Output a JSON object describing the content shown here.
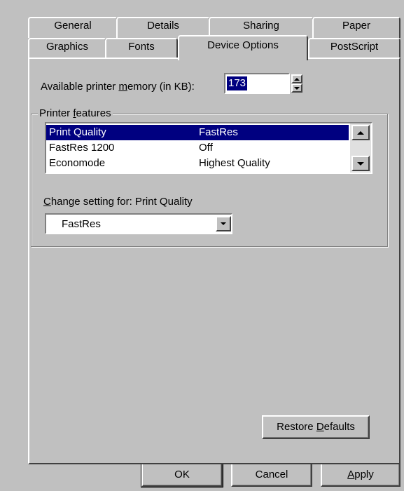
{
  "tabs_back": [
    {
      "label": "General"
    },
    {
      "label": "Details"
    },
    {
      "label": "Sharing"
    },
    {
      "label": "Paper"
    }
  ],
  "tabs_front": [
    {
      "label": "Graphics"
    },
    {
      "label": "Fonts"
    },
    {
      "label": "Device Options"
    },
    {
      "label": "PostScript"
    }
  ],
  "memory": {
    "label_pre": "Available printer ",
    "label_u": "m",
    "label_post": "emory (in KB):",
    "value": "173"
  },
  "features": {
    "group_pre": "Printer ",
    "group_u": "f",
    "group_post": "eatures",
    "rows": [
      {
        "name": "Print Quality",
        "value": "FastRes"
      },
      {
        "name": "FastRes 1200",
        "value": "Off"
      },
      {
        "name": "Economode",
        "value": "Highest Quality"
      }
    ]
  },
  "change_setting": {
    "label_u": "C",
    "label_post": "hange setting for:  Print Quality",
    "selected": "FastRes"
  },
  "buttons": {
    "restore_pre": "Restore ",
    "restore_u": "D",
    "restore_post": "efaults",
    "ok": "OK",
    "cancel": "Cancel",
    "apply_u": "A",
    "apply_post": "pply"
  },
  "colors": {
    "dialog_bg": "#c0c0c0",
    "selection": "#000080"
  }
}
